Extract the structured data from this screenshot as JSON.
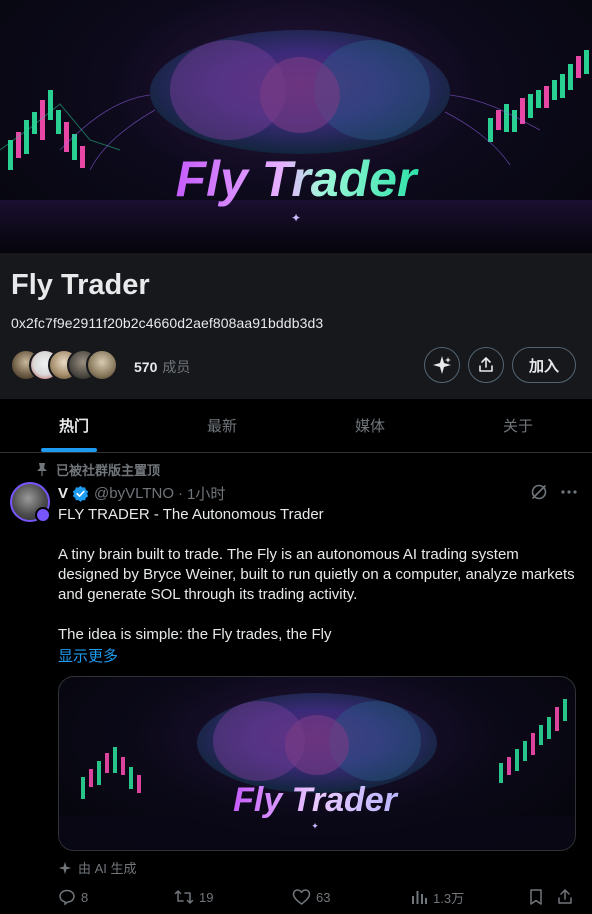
{
  "banner": {
    "title_art": "Fly Trader"
  },
  "community": {
    "title": "Fly Trader",
    "address": "0x2fc7f9e2911f20b2c4660d2aef808aa91bddb3d3",
    "member_count": "570",
    "member_label": "成员",
    "join_label": "加入"
  },
  "tabs": [
    {
      "label": "热门",
      "active": true
    },
    {
      "label": "最新",
      "active": false
    },
    {
      "label": "媒体",
      "active": false
    },
    {
      "label": "关于",
      "active": false
    }
  ],
  "post": {
    "pinned_label": "已被社群版主置顶",
    "author_name": "V",
    "handle": "@byVLTNO",
    "time": "1小时",
    "text_lines": [
      "FLY TRADER - The Autonomous Trader",
      "A tiny brain built to trade. The Fly is an autonomous AI trading system designed by Bryce Weiner, built to run quietly on a computer, analyze markets and generate SOL through its trading activity.",
      "The idea is simple: the Fly trades, the Fly"
    ],
    "show_more": "显示更多",
    "media_title_art": "Fly Trader",
    "ai_label": "由 AI 生成",
    "replies": "8",
    "reposts": "19",
    "likes": "63",
    "views": "1.3万"
  },
  "colors": {
    "accent": "#1d9bf0",
    "background": "#000000",
    "panel": "#16181c",
    "muted": "#71767b",
    "badge": "#7856ff"
  }
}
